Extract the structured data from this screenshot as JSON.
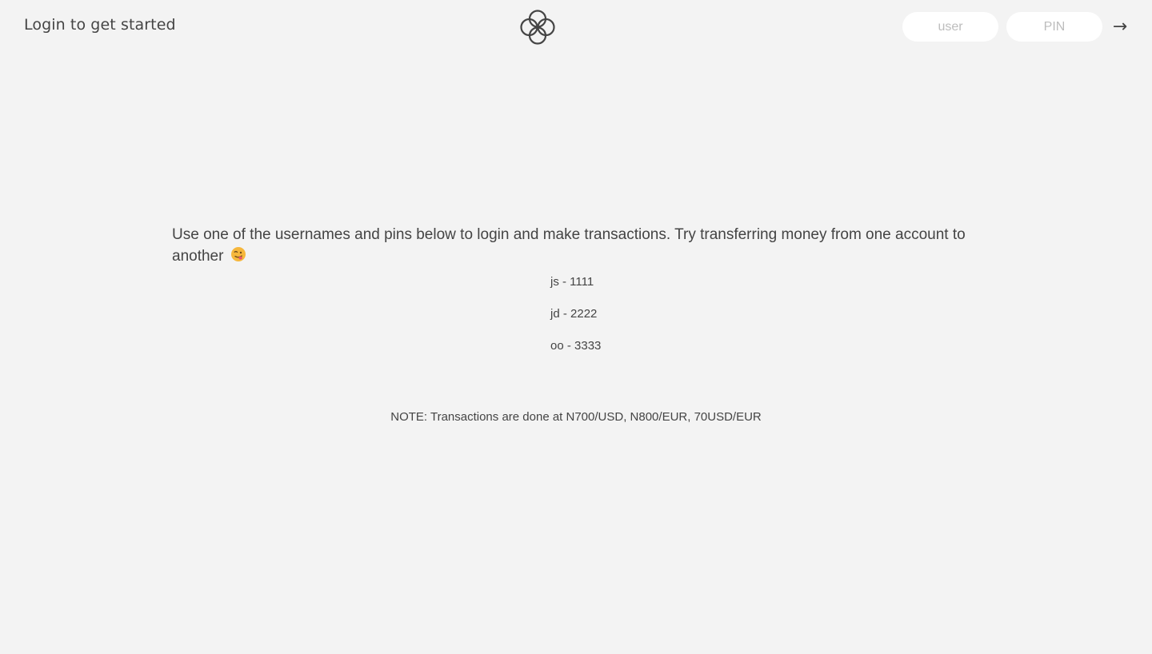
{
  "nav": {
    "welcome": "Login to get started",
    "logo_icon": "bankist-logo-icon",
    "user_placeholder": "user",
    "pin_placeholder": "PIN",
    "login_label": "→"
  },
  "main": {
    "intro": "Use one of the usernames and pins below to login and make transactions. Try transferring money from one account to another",
    "emoji_icon": "face-with-tongue-emoji-icon",
    "credentials": [
      "js - 1111",
      "jd - 2222",
      "oo - 3333"
    ],
    "note": "NOTE: Transactions are done at N700/USD, N800/EUR, 70USD/EUR"
  },
  "colors": {
    "background": "#f3f3f3",
    "text": "#444444",
    "input_bg": "#ffffff",
    "placeholder": "#bdbdbd",
    "emoji": "#f6b73c"
  }
}
